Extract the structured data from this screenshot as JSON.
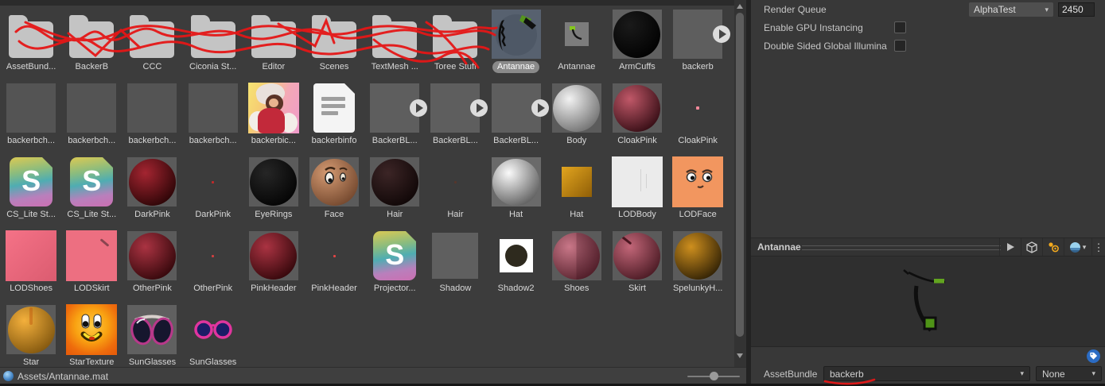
{
  "project": {
    "status_path": "Assets/Antannae.mat",
    "zoom_slider": {
      "value_pct": 50
    },
    "items": [
      {
        "label": "AssetBund...",
        "kind": "folder"
      },
      {
        "label": "BackerB",
        "kind": "folder"
      },
      {
        "label": "CCC",
        "kind": "folder"
      },
      {
        "label": "Ciconia St...",
        "kind": "folder"
      },
      {
        "label": "Editor",
        "kind": "folder"
      },
      {
        "label": "Scenes",
        "kind": "folder"
      },
      {
        "label": "TextMesh ...",
        "kind": "folder"
      },
      {
        "label": "Toree Stuff",
        "kind": "folder"
      },
      {
        "label": "Antannae",
        "kind": "mat_antennae",
        "selected": true
      },
      {
        "label": "Antannae",
        "kind": "tex_antennae"
      },
      {
        "label": "ArmCuffs",
        "kind": "sphere",
        "bg": "#616161",
        "c1": "#1a1a1a",
        "c2": "#000000"
      },
      {
        "label": "backerb",
        "kind": "playsquare"
      },
      {
        "label": "backerbch...",
        "kind": "square",
        "color": "#545454",
        "size": 62
      },
      {
        "label": "backerbch...",
        "kind": "square",
        "color": "#545454",
        "size": 62
      },
      {
        "label": "backerbch...",
        "kind": "square",
        "color": "#545454",
        "size": 62
      },
      {
        "label": "backerbch...",
        "kind": "square",
        "color": "#545454",
        "size": 62
      },
      {
        "label": "backerbic...",
        "kind": "art"
      },
      {
        "label": "backerbinfo",
        "kind": "doc"
      },
      {
        "label": "BackerBL...",
        "kind": "playsquare"
      },
      {
        "label": "BackerBL...",
        "kind": "playsquare"
      },
      {
        "label": "BackerBL...",
        "kind": "playsquare"
      },
      {
        "label": "Body",
        "kind": "sphere",
        "c1": "#f2f2f2",
        "c2": "#6a6a6a"
      },
      {
        "label": "CloakPink",
        "kind": "sphere",
        "c1": "#c05868",
        "c2": "#2e0910"
      },
      {
        "label": "CloakPink",
        "kind": "dot",
        "color": "#f2899a",
        "size": 4
      },
      {
        "label": "CS_Lite St...",
        "kind": "s_icon"
      },
      {
        "label": "CS_Lite St...",
        "kind": "s_icon"
      },
      {
        "label": "DarkPink",
        "kind": "sphere",
        "c1": "#a42531",
        "c2": "#250304"
      },
      {
        "label": "DarkPink",
        "kind": "dot",
        "color": "#c22a2a",
        "size": 3
      },
      {
        "label": "EyeRings",
        "kind": "sphere",
        "c1": "#262626",
        "c2": "#020202"
      },
      {
        "label": "Face",
        "kind": "sphere",
        "c1": "#d49a72",
        "c2": "#6e432a",
        "face": true
      },
      {
        "label": "Hair",
        "kind": "sphere",
        "c1": "#3c2526",
        "c2": "#0d0505"
      },
      {
        "label": "Hair",
        "kind": "dot",
        "color": "#56362c",
        "size": 3
      },
      {
        "label": "Hat",
        "kind": "sphere",
        "bg": "#6a6a6a",
        "c1": "#fafafa",
        "c2": "#565656"
      },
      {
        "label": "Hat",
        "kind": "square",
        "size": 38,
        "grad": [
          "#e2a51f",
          "#8f5e07"
        ]
      },
      {
        "label": "LODBody",
        "kind": "square",
        "size": 64,
        "color": "#ebebeb",
        "lines": true
      },
      {
        "label": "LODFace",
        "kind": "lodface"
      },
      {
        "label": "LODShoes",
        "kind": "square",
        "size": 64,
        "grad": [
          "#f57287",
          "#db5c70"
        ]
      },
      {
        "label": "LODSkirt",
        "kind": "square",
        "size": 64,
        "color": "#ed6f81",
        "mark": true
      },
      {
        "label": "OtherPink",
        "kind": "sphere",
        "c1": "#aa3342",
        "c2": "#2e0508"
      },
      {
        "label": "OtherPink",
        "kind": "dot",
        "color": "#d04040",
        "size": 3
      },
      {
        "label": "PinkHeader",
        "kind": "sphere",
        "c1": "#aa3342",
        "c2": "#2e0508"
      },
      {
        "label": "PinkHeader",
        "kind": "dot",
        "color": "#e24444",
        "size": 3
      },
      {
        "label": "Projector...",
        "kind": "s_icon"
      },
      {
        "label": "Shadow",
        "kind": "square",
        "size": 58,
        "color": "#5f5f5f"
      },
      {
        "label": "Shadow2",
        "kind": "shadow2"
      },
      {
        "label": "Shoes",
        "kind": "sphere",
        "c1": "#c97788",
        "c2": "#54202b",
        "split": true
      },
      {
        "label": "Skirt",
        "kind": "sphere",
        "c1": "#c26678",
        "c2": "#44161f",
        "crack": true
      },
      {
        "label": "SpelunkyH...",
        "kind": "sphere",
        "c1": "#ce8f1e",
        "c2": "#281b04"
      },
      {
        "label": "Star",
        "kind": "sphere",
        "c1": "#f4b03c",
        "c2": "#7c520c",
        "streak": true
      },
      {
        "label": "StarTexture",
        "kind": "star_tex"
      },
      {
        "label": "SunGlasses",
        "kind": "sun_mat"
      },
      {
        "label": "SunGlasses",
        "kind": "sun_tex"
      }
    ]
  },
  "inspector": {
    "render_queue": {
      "label": "Render Queue",
      "mode": "AlphaTest",
      "value": "2450"
    },
    "gpu_instancing": {
      "label": "Enable GPU Instancing",
      "checked": false
    },
    "double_sided_gi": {
      "label": "Double Sided Global Illumina",
      "checked": false
    },
    "preview": {
      "title": "Antannae"
    },
    "assetbundle": {
      "label": "AssetBundle",
      "bundle": "backerb",
      "variant": "None"
    }
  },
  "icons": {
    "preview_toolbar": [
      "play-icon",
      "cube-icon",
      "light-icon",
      "render-mode-sphere-icon",
      "kebab-menu-icon"
    ],
    "assetbundle_badge": "tag-icon",
    "status_icon": "material-sphere-icon"
  },
  "colors": {
    "panel_bg": "#3c3c3c",
    "inspector_bg": "#383838",
    "accent_blue": "#2b6cc4",
    "annotation_ink": "#e51717"
  }
}
